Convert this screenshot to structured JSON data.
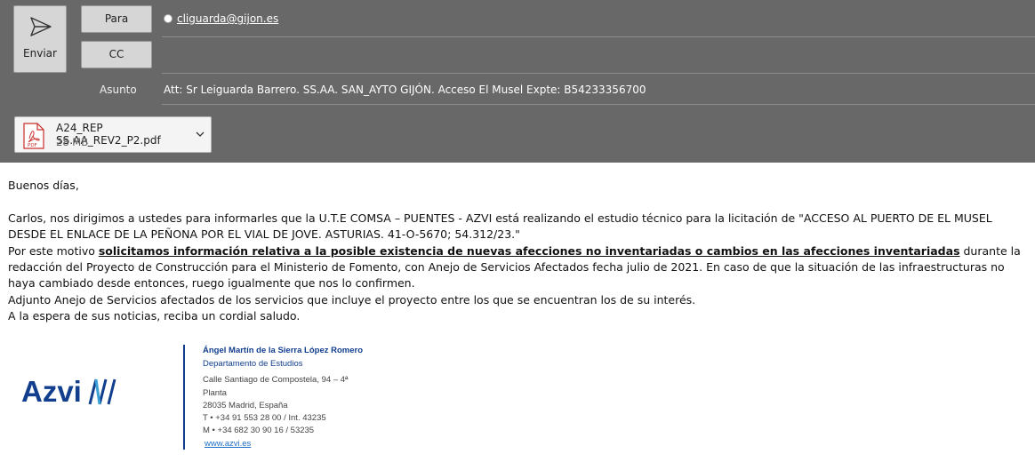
{
  "compose": {
    "send_label": "Enviar",
    "to_label": "Para",
    "cc_label": "CC",
    "to_recipient": "cliguarda@gijon.es",
    "subject_label": "Asunto",
    "subject_value": "Att: Sr Leiguarda Barrero. SS.AA. SAN_AYTO GIJÓN. Acceso El Musel Expte: B54233356700"
  },
  "attachment": {
    "file_name": "A24_REP SS.AA_REV2_P2.pdf",
    "file_size": "28 MB",
    "icon": "pdf-file-icon"
  },
  "body": {
    "greeting": "Buenos días,",
    "p1": "Carlos, nos dirigimos a ustedes para informarles que la U.T.E COMSA – PUENTES - AZVI está realizando el estudio técnico para la licitación de \"ACCESO AL PUERTO DE EL MUSEL DESDE EL ENLACE  DE LA PEÑONA POR EL VIAL DE JOVE. ASTURIAS. 41-O-5670; 54.312/23.\"",
    "p2_prefix": "Por este motivo ",
    "p2_bold": "solicitamos información relativa a la posible existencia de nuevas afecciones no inventariadas o cambios en las afecciones inventariadas",
    "p2_suffix": " durante la redacción del Proyecto de Construcción para el Ministerio de Fomento, con Anejo de Servicios Afectados fecha julio de 2021. En caso de que la situación de las infraestructuras no haya cambiado desde entonces, ruego igualmente que nos lo confirmen.",
    "p3": "Adjunto Anejo de Servicios afectados de los servicios que incluye el proyecto entre los que se encuentran los de su interés.",
    "p4": "A la espera de sus noticias, reciba un cordial saludo."
  },
  "signature": {
    "logo_text": "Azvi",
    "name": "Ángel Martín de la Sierra López Romero",
    "department": "Departamento de Estudios",
    "address1": "Calle Santiago de Compostela, 94 – 4ª",
    "address2": "Planta",
    "address3": "28035 Madrid, España",
    "phone": "T •  +34 91 553 28 00 / Int. 43235",
    "mobile": "M •  +34 682 30 90 16 / 53235",
    "website": "www.azvi.es"
  },
  "colors": {
    "header_bg": "#686868",
    "brand_blue": "#123e8e",
    "link_blue": "#1f6fc5"
  }
}
